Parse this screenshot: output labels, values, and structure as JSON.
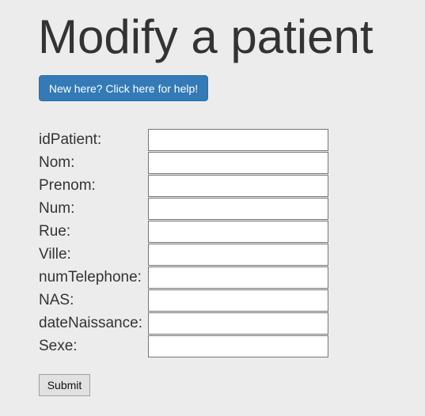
{
  "page": {
    "title": "Modify a patient"
  },
  "help_button": {
    "label": "New here? Click here for help!"
  },
  "form": {
    "fields": [
      {
        "label": "idPatient:",
        "value": ""
      },
      {
        "label": "Nom:",
        "value": ""
      },
      {
        "label": "Prenom:",
        "value": ""
      },
      {
        "label": "Num:",
        "value": ""
      },
      {
        "label": "Rue:",
        "value": ""
      },
      {
        "label": "Ville:",
        "value": ""
      },
      {
        "label": "numTelephone:",
        "value": ""
      },
      {
        "label": "NAS:",
        "value": ""
      },
      {
        "label": "dateNaissance:",
        "value": ""
      },
      {
        "label": "Sexe:",
        "value": ""
      }
    ],
    "submit_label": "Submit"
  },
  "colors": {
    "background": "#ececec",
    "primary_button": "#337ab7",
    "text": "#333333"
  }
}
